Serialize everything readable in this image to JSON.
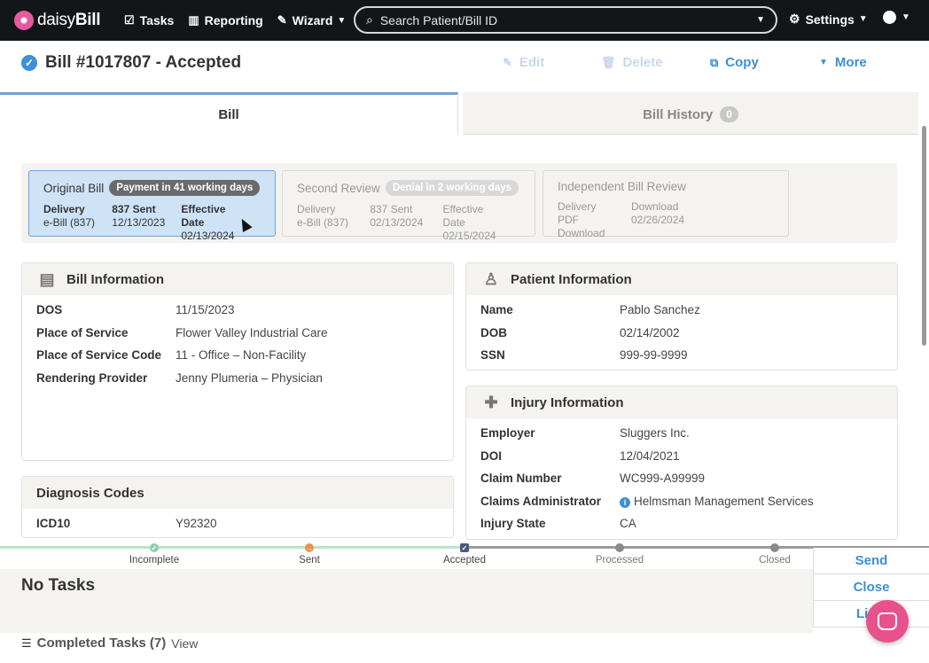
{
  "nav": {
    "brand_prefix": "daisy",
    "brand_suffix": "Bill",
    "tasks": "Tasks",
    "reporting": "Reporting",
    "wizard": "Wizard",
    "search_placeholder": "Search Patient/Bill ID",
    "settings": "Settings"
  },
  "header": {
    "title": "Bill #1017807 - Accepted",
    "edit": "Edit",
    "delete": "Delete",
    "copy": "Copy",
    "more": "More"
  },
  "tabs": {
    "bill": "Bill",
    "history": "Bill History",
    "history_count": "0"
  },
  "reviews": [
    {
      "title": "Original Bill",
      "badge": "Payment in 41 working days",
      "cols": [
        {
          "label": "Delivery",
          "value": "e-Bill (837)"
        },
        {
          "label": "837 Sent",
          "value": "12/13/2023"
        },
        {
          "label": "Effective Date",
          "value": "02/13/2024"
        }
      ]
    },
    {
      "title": "Second Review",
      "badge": "Denial in 2 working days",
      "cols": [
        {
          "label": "Delivery",
          "value": "e-Bill (837)"
        },
        {
          "label": "837 Sent",
          "value": "02/13/2024"
        },
        {
          "label": "Effective Date",
          "value": "02/15/2024"
        }
      ]
    },
    {
      "title": "Independent Bill Review",
      "badge": "",
      "cols": [
        {
          "label": "Delivery",
          "value": "PDF Download"
        },
        {
          "label": "Download",
          "value": "02/26/2024"
        }
      ]
    }
  ],
  "bill_info": {
    "title": "Bill Information",
    "rows": [
      {
        "k": "DOS",
        "v": "11/15/2023"
      },
      {
        "k": "Place of Service",
        "v": "Flower Valley Industrial Care"
      },
      {
        "k": "Place of Service Code",
        "v": "11 - Office – Non-Facility"
      },
      {
        "k": "Rendering Provider",
        "v": "Jenny Plumeria – Physician"
      }
    ]
  },
  "diagnosis": {
    "title": "Diagnosis Codes",
    "rows": [
      {
        "k": "ICD10",
        "v": "Y92320"
      }
    ]
  },
  "patient_info": {
    "title": "Patient Information",
    "rows": [
      {
        "k": "Name",
        "v": "Pablo Sanchez"
      },
      {
        "k": "DOB",
        "v": "02/14/2002"
      },
      {
        "k": "SSN",
        "v": "999-99-9999"
      }
    ]
  },
  "injury_info": {
    "title": "Injury Information",
    "rows": [
      {
        "k": "Employer",
        "v": "Sluggers Inc."
      },
      {
        "k": "DOI",
        "v": "12/04/2021"
      },
      {
        "k": "Claim Number",
        "v": "WC999-A99999"
      },
      {
        "k": "Claims Administrator",
        "v": "Helmsman Management Services"
      },
      {
        "k": "Injury State",
        "v": "CA"
      }
    ]
  },
  "progress": {
    "steps": [
      "Incomplete",
      "Sent",
      "Accepted",
      "Processed",
      "Closed"
    ],
    "colors": {
      "done": "#8ccfa8",
      "sent": "#e8954a",
      "accepted": "#4a5a7a",
      "future": "#8a8a8a"
    }
  },
  "tasks": {
    "empty": "No Tasks",
    "completed": "Completed Tasks (7)",
    "view": "View"
  },
  "side_actions": {
    "send": "Send",
    "close": "Close",
    "third": "Li"
  }
}
